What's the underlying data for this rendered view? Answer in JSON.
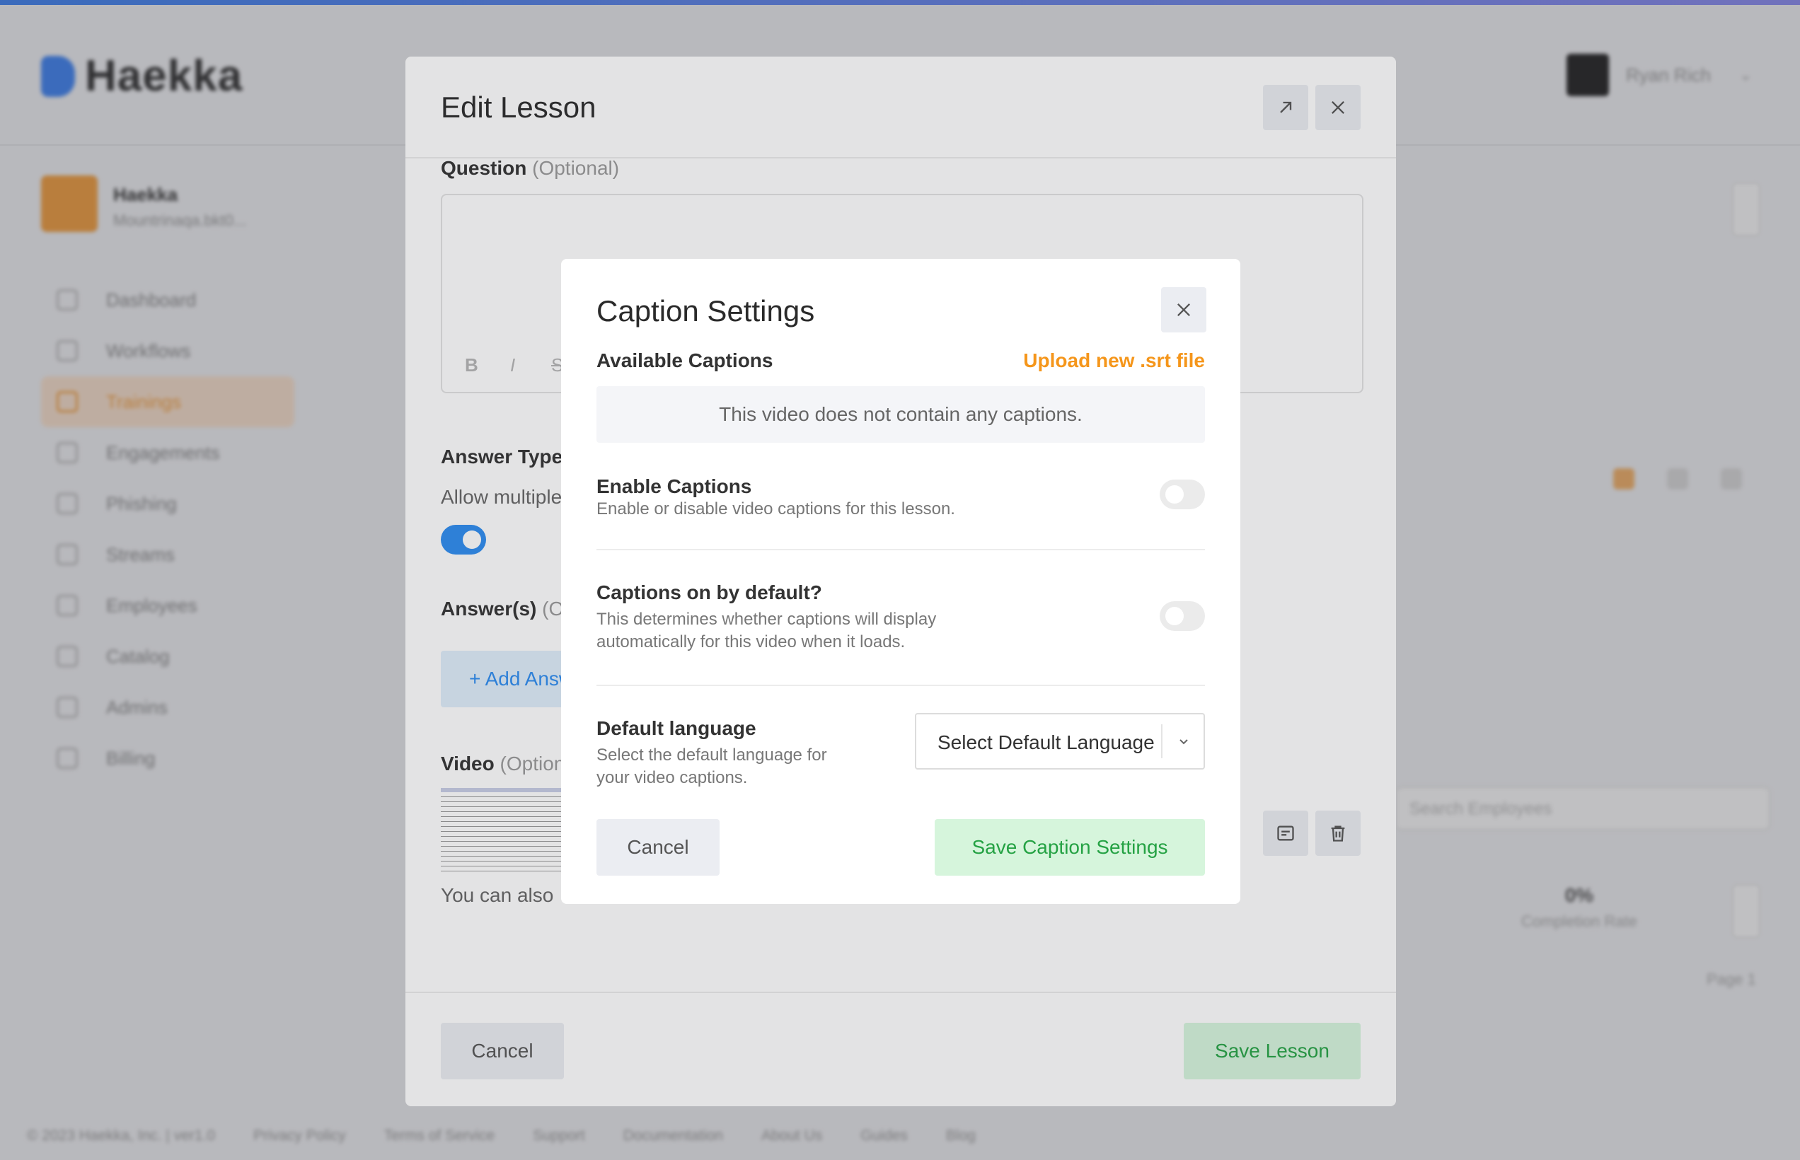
{
  "app": {
    "brand": "Haekka",
    "user_name": "Ryan Rich",
    "org_name": "Haekka",
    "org_sub": "Mountrinaqa.bkt0..."
  },
  "sidebar": {
    "items": [
      {
        "label": "Dashboard",
        "active": false
      },
      {
        "label": "Workflows",
        "active": false
      },
      {
        "label": "Trainings",
        "active": true
      },
      {
        "label": "Engagements",
        "active": false
      },
      {
        "label": "Phishing",
        "active": false
      },
      {
        "label": "Streams",
        "active": false
      },
      {
        "label": "Employees",
        "active": false
      },
      {
        "label": "Catalog",
        "active": false
      },
      {
        "label": "Admins",
        "active": false
      },
      {
        "label": "Billing",
        "active": false
      }
    ]
  },
  "background": {
    "search_placeholder": "Search Employees",
    "stat_value": "0%",
    "stat_label": "Completion Rate",
    "pager": "Page 1"
  },
  "footer": {
    "links": [
      "© 2023 Haekka, Inc. | ver1.0",
      "Privacy Policy",
      "Terms of Service",
      "Support",
      "Documentation",
      "About Us",
      "Guides",
      "Blog"
    ]
  },
  "edit_lesson": {
    "title": "Edit Lesson",
    "question_label": "Question",
    "question_optional": "(Optional)",
    "toolbar": {
      "bold": "B",
      "italic": "I",
      "strike": "S"
    },
    "answer_type_label": "Answer Type",
    "allow_multiple_text": "Allow multiple",
    "allow_multiple_on": true,
    "answers_label": "Answer(s)",
    "answers_optional": "(O",
    "add_answer_label": "+ Add Answer",
    "video_label": "Video",
    "video_optional": "(Optional)",
    "also_text": "You can also",
    "cancel_label": "Cancel",
    "save_label": "Save Lesson"
  },
  "caption_settings": {
    "title": "Caption Settings",
    "available_label": "Available Captions",
    "upload_label": "Upload new .srt file",
    "empty_text": "This video does not contain any captions.",
    "enable": {
      "title": "Enable Captions",
      "desc": "Enable or disable video captions for this lesson.",
      "on": false
    },
    "default_on": {
      "title": "Captions on by default?",
      "desc_line1": "This determines whether captions will display",
      "desc_line2": "automatically for this video when it loads.",
      "on": false
    },
    "language": {
      "title": "Default language",
      "desc_line1": "Select the default language for",
      "desc_line2": "your video captions.",
      "selected": "Select Default Language"
    },
    "cancel_label": "Cancel",
    "save_label": "Save Caption Settings"
  },
  "colors": {
    "accent_orange": "#f5961b",
    "accent_blue": "#2d8cf0",
    "success_green": "#25a244",
    "success_bg": "#d6f5dc"
  }
}
